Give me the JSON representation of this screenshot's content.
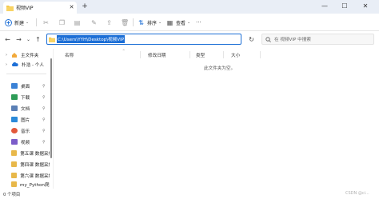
{
  "tab": {
    "title": "视频VIP",
    "close_icon": "✕",
    "new_tab_icon": "+"
  },
  "window": {
    "minimize": "—",
    "maximize": "☐",
    "close": "✕"
  },
  "toolbar": {
    "new_label": "新建",
    "sort_label": "排序",
    "view_label": "查看",
    "more": "···"
  },
  "address": {
    "path": "C:\\Users\\YYH\\Desktop\\视频VIP",
    "search_placeholder": "在 视频VIP 中搜索"
  },
  "sidebar": {
    "home": "主文件夹",
    "cloud": "朴浩 - 个人",
    "items": [
      {
        "label": "桌面",
        "color": "#3b82d6",
        "pinned": true,
        "selected": false
      },
      {
        "label": "下载",
        "color": "#2e9c57",
        "pinned": true,
        "selected": false
      },
      {
        "label": "文档",
        "color": "#5a7fb5",
        "pinned": true,
        "selected": false
      },
      {
        "label": "图片",
        "color": "#2b8ad9",
        "pinned": true,
        "selected": false
      },
      {
        "label": "音乐",
        "color": "#e2583b",
        "pinned": true,
        "selected": false
      },
      {
        "label": "视频",
        "color": "#7b5cc9",
        "pinned": true,
        "selected": false
      },
      {
        "label": "第五课 数据采集",
        "color": "#e8b84a",
        "pinned": false,
        "selected": false
      },
      {
        "label": "第四课 数据采集",
        "color": "#e8b84a",
        "pinned": false,
        "selected": false
      },
      {
        "label": "第六课 数据采集",
        "color": "#e8b84a",
        "pinned": false,
        "selected": false
      },
      {
        "label": "my_Python爬虫",
        "color": "#e8b84a",
        "pinned": false,
        "selected": false
      }
    ]
  },
  "columns": {
    "name": "名称",
    "modified": "修改日期",
    "type": "类型",
    "size": "大小"
  },
  "empty_message": "此文件夹为空。",
  "status": {
    "count": "0 个项目",
    "watermark": "CSDN @ci..."
  }
}
